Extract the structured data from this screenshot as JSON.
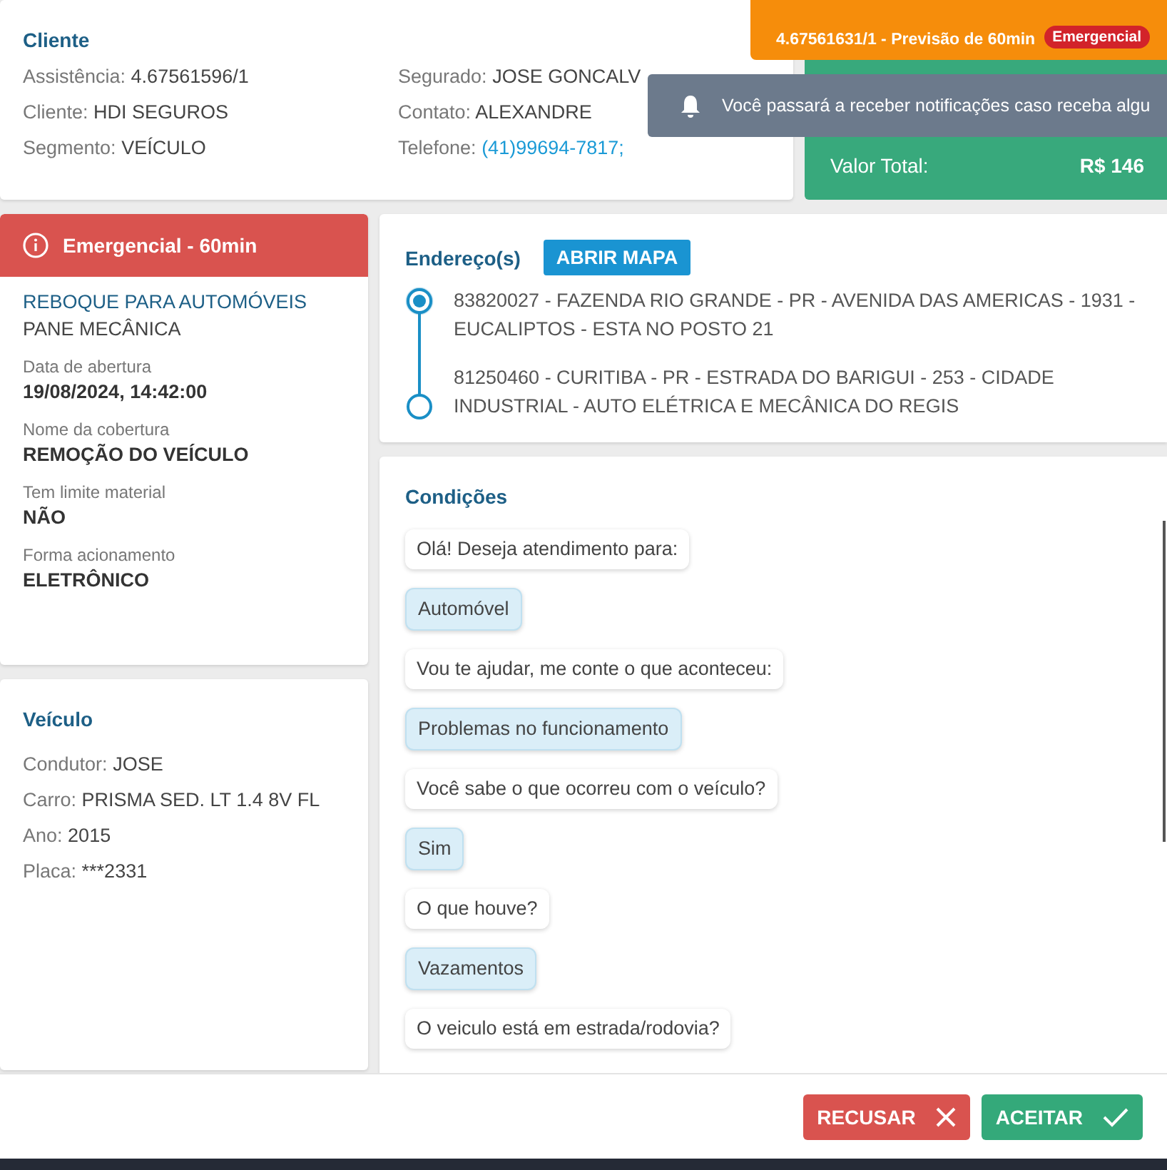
{
  "client_card": {
    "title": "Cliente",
    "fields": [
      {
        "label": "Assistência:",
        "value": "4.67561596/1",
        "kind": "text"
      },
      {
        "label": "Segurado:",
        "value": "JOSE GONCALV",
        "kind": "text"
      },
      {
        "label": "Cliente:",
        "value": "HDI SEGUROS",
        "kind": "text"
      },
      {
        "label": "Contato:",
        "value": "ALEXANDRE",
        "kind": "text"
      },
      {
        "label": "Segmento:",
        "value": "VEÍCULO",
        "kind": "text"
      },
      {
        "label": "Telefone:",
        "value": "(41)99694-7817;",
        "kind": "link"
      }
    ]
  },
  "total_card": {
    "label": "Valor Total:",
    "value": "R$ 146"
  },
  "new_service_toast": {
    "subtitle": "4.67561631/1 - Previsão de 60min",
    "badge": "Emergencial"
  },
  "notification": {
    "text": "Você passará a receber notificações caso receba algu"
  },
  "service_card": {
    "banner": "Emergencial - 60min",
    "service": "REBOQUE PARA AUTOMÓVEIS",
    "problem": "PANE MECÂNICA",
    "details": [
      {
        "label": "Data de abertura",
        "value": "19/08/2024, 14:42:00"
      },
      {
        "label": "Nome da cobertura",
        "value": "REMOÇÃO DO VEÍCULO"
      },
      {
        "label": "Tem limite material",
        "value": "NÃO"
      },
      {
        "label": "Forma acionamento",
        "value": "ELETRÔNICO"
      }
    ]
  },
  "vehicle_card": {
    "title": "Veículo",
    "fields": [
      {
        "label": "Condutor:",
        "value": "JOSE"
      },
      {
        "label": "Carro:",
        "value": "PRISMA SED. LT 1.4 8V FL"
      },
      {
        "label": "Ano:",
        "value": "2015"
      },
      {
        "label": "Placa:",
        "value": "***2331"
      }
    ]
  },
  "addresses": {
    "title": "Endereço(s)",
    "map_button": "ABRIR MAPA",
    "items": [
      {
        "text": "83820027 - FAZENDA RIO GRANDE - PR - AVENIDA DAS AMERICAS - 1931 - EUCALIPTOS - ESTA NO POSTO 21",
        "selected": true
      },
      {
        "text": "81250460 - CURITIBA - PR - ESTRADA DO BARIGUI - 253 - CIDADE INDUSTRIAL - AUTO ELÉTRICA E MECÂNICA DO REGIS",
        "selected": false
      }
    ]
  },
  "conditions": {
    "title": "Condições",
    "messages": [
      {
        "kind": "question",
        "text": "Olá! Deseja atendimento para:"
      },
      {
        "kind": "answer",
        "text": "Automóvel"
      },
      {
        "kind": "question",
        "text": "Vou te ajudar, me conte o que aconteceu:"
      },
      {
        "kind": "answer",
        "text": "Problemas no funcionamento"
      },
      {
        "kind": "question",
        "text": "Você sabe o que ocorreu com o veículo?"
      },
      {
        "kind": "answer",
        "text": "Sim"
      },
      {
        "kind": "question",
        "text": "O que houve?"
      },
      {
        "kind": "answer",
        "text": "Vazamentos"
      },
      {
        "kind": "question",
        "text": "O veiculo está em estrada/rodovia?"
      }
    ]
  },
  "actions": [
    {
      "kind": "reject",
      "label": "RECUSAR"
    },
    {
      "kind": "accept",
      "label": "ACEITAR"
    }
  ]
}
